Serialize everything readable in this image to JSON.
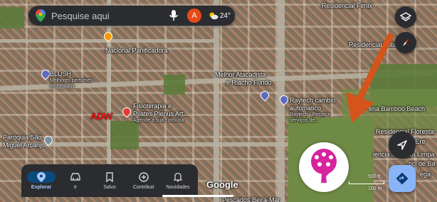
{
  "search": {
    "placeholder": "Pesquise aqui",
    "avatar_letter": "A",
    "temperature": "24°"
  },
  "places": {
    "residencial_fenix": "Residencial Fenix",
    "residencial_este": "Residencial Este",
    "nacional_panificadora": "Nacional Panificadora",
    "blush": "BLUSH",
    "blush_sub_1": "Melhores perfumes",
    "blush_sub_2": "importados",
    "melhor_atacadista_1": "Melhor Atacadista",
    "melhor_atacadista_2": "e Riacho Fundo",
    "raytech_1": "Raytech cambio",
    "raytech_2": "automatico",
    "raytech_sub_1": "Raytech - Peças e",
    "raytech_sub_2": "serviços de...",
    "bamboo": "ena Bamboo Beach",
    "fisioterapia_1": "Fisioterapia e",
    "fisioterapia_2": "Pilates Plenus Art...",
    "fisioterapia_sub": "Agende a sua consulta",
    "adw": "ADW",
    "paroquia_1": "Paróquia São",
    "paroquia_2": "Miguel Arcanjo",
    "residencial_floresta": "Residencial Floresta",
    "residencial_ere": "ial Ere",
    "agua_limpa": "iencia de Água Limpa",
    "centro_ba": "nci de Ba",
    "pescados": "Pescados Beira-Mar",
    "ega": "ega"
  },
  "nav": {
    "items": [
      {
        "label": "Explorar",
        "icon": "location-pin-icon",
        "active": true
      },
      {
        "label": "Ir",
        "icon": "car-icon",
        "active": false
      },
      {
        "label": "Salvo",
        "icon": "bookmark-icon",
        "active": false
      },
      {
        "label": "Contribuir",
        "icon": "add-circle-icon",
        "active": false
      },
      {
        "label": "Novidades",
        "icon": "bell-icon",
        "active": false
      }
    ]
  },
  "map": {
    "attribution": "Google",
    "scale_label": "500 ft",
    "scale_label_2": "100 m"
  },
  "colors": {
    "accent": "#a8c8fa",
    "avatar": "#e64a19",
    "arrow": "#d4541c",
    "navigate": "#8ab4f8",
    "logo_tree": "#d6249f"
  }
}
